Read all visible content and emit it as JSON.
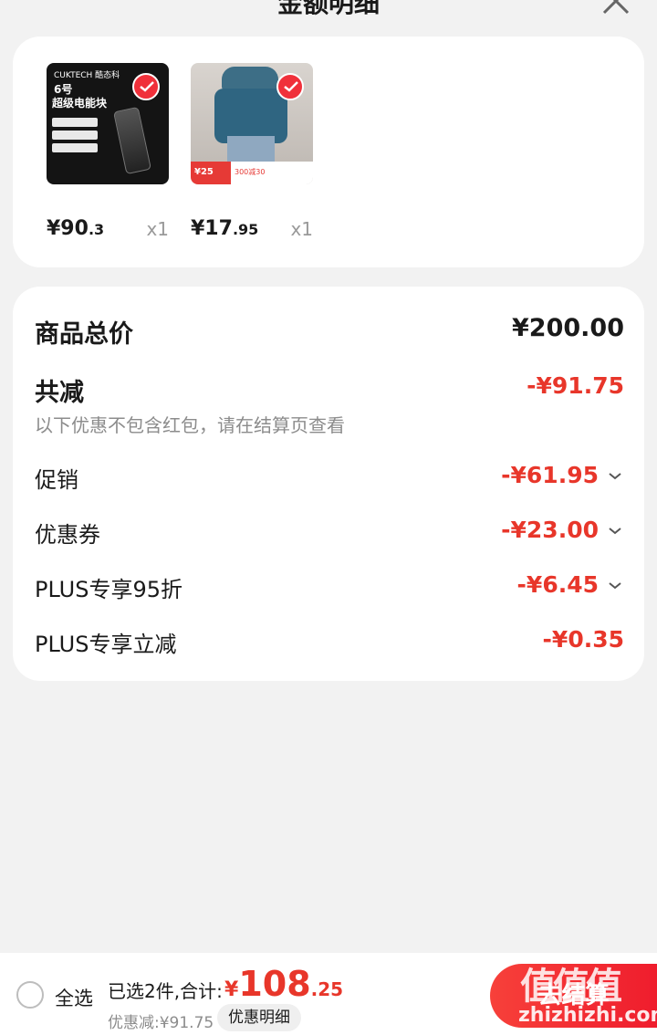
{
  "header": {
    "title": "金额明细"
  },
  "products": [
    {
      "price_int": "¥90",
      "price_dec": ".3",
      "qty": "x1",
      "thumb_lines": [
        "CUKTECH 酷态科",
        "6号",
        "超级电能块"
      ]
    },
    {
      "price_int": "¥17",
      "price_dec": ".95",
      "qty": "x1",
      "thumb_lines": [
        "¥25",
        "300减30"
      ]
    }
  ],
  "summary": {
    "total_label": "商品总价",
    "total_value": "¥200.00",
    "reduce_label": "共减",
    "reduce_value": "-¥91.75",
    "note": "以下优惠不包含红包，请在结算页查看",
    "items": [
      {
        "label": "促销",
        "value": "-¥61.95",
        "expandable": true
      },
      {
        "label": "优惠券",
        "value": "-¥23.00",
        "expandable": true
      },
      {
        "label": "PLUS专享95折",
        "value": "-¥6.45",
        "expandable": true
      },
      {
        "label": "PLUS专享立减",
        "value": "-¥0.35",
        "expandable": false
      }
    ]
  },
  "bottom": {
    "select_all": "全选",
    "selected_text": "已选2件,合计:",
    "total_currency": "¥",
    "total_int": "108",
    "total_dec": ".25",
    "discount_text": "优惠减:¥91.75",
    "detail_button": "优惠明细",
    "checkout_button": "去结算"
  },
  "watermark": {
    "logo": "值值值",
    "url": "zhizhizhi.com"
  },
  "colors": {
    "accent": "#e8362a",
    "background": "#f2f2f2"
  }
}
